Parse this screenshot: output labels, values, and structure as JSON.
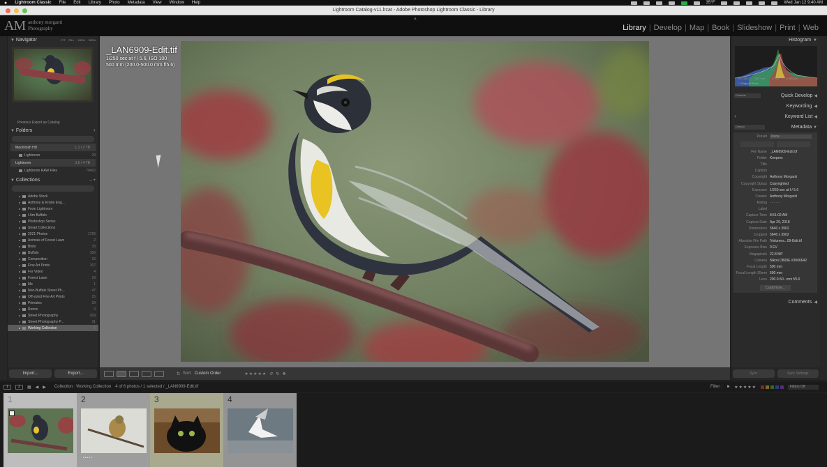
{
  "menubar": {
    "apple": "",
    "items": [
      "Lightroom Classic",
      "File",
      "Edit",
      "Library",
      "Photo",
      "Metadata",
      "View",
      "Window",
      "Help"
    ],
    "temperature": "35°F",
    "clock": "Wed Jan 12  9:40 AM"
  },
  "window": {
    "title": "Lightroom Catalog-v11.lrcat - Adobe Photoshop Lightroom Classic - Library"
  },
  "identity": {
    "initials": "AM",
    "line1": "anthony morganti",
    "line2": "Photography"
  },
  "modules": [
    "Library",
    "Develop",
    "Map",
    "Book",
    "Slideshow",
    "Print",
    "Web"
  ],
  "active_module": "Library",
  "navigator": {
    "title": "Navigator",
    "zoom": [
      "FIT",
      "FILL",
      "100%",
      "200%"
    ]
  },
  "left": {
    "prev_export": "Previous Export as Catalog",
    "folders_title": "Folders",
    "volumes": [
      {
        "name": "Macintosh HD",
        "count": "1.1 / 2 TB"
      },
      {
        "name": "Lightroom",
        "count": "3.5 / 4 TB"
      }
    ],
    "folder_rows": [
      {
        "name": "Lightroom",
        "count": "29"
      },
      {
        "name": "Lightroom RAW Files",
        "count": "70462"
      }
    ],
    "collections_title": "Collections",
    "collections": [
      {
        "name": "Adobe Stock",
        "count": ""
      },
      {
        "name": "Anthony & Kristie Eng...",
        "count": ""
      },
      {
        "name": "From Lightroom",
        "count": ""
      },
      {
        "name": "I Am Buffalo",
        "count": ""
      },
      {
        "name": "Photoshop Series",
        "count": ""
      },
      {
        "name": "Smart Collections",
        "count": ""
      },
      {
        "name": "2021 Photos",
        "count": "1726"
      },
      {
        "name": "Animals of Forest Lawn",
        "count": "2"
      },
      {
        "name": "Birds",
        "count": "33"
      },
      {
        "name": "Buffalo",
        "count": "156"
      },
      {
        "name": "Composition",
        "count": "23"
      },
      {
        "name": "Fine Art Prints",
        "count": "167"
      },
      {
        "name": "For Video",
        "count": "4"
      },
      {
        "name": "Forest Lawn",
        "count": "19"
      },
      {
        "name": "Me",
        "count": "1"
      },
      {
        "name": "Non-Buffalo Street Ph...",
        "count": "47"
      },
      {
        "name": "Off-sized Fine Art Prints",
        "count": "15"
      },
      {
        "name": "Primates",
        "count": "29"
      },
      {
        "name": "Remix",
        "count": "3"
      },
      {
        "name": "Street Photography",
        "count": "269"
      },
      {
        "name": "Street Photography P...",
        "count": "31"
      },
      {
        "name": "Working Collection",
        "count": "6"
      }
    ],
    "selected_collection": "Working Collection",
    "import_label": "Import...",
    "export_label": "Export..."
  },
  "loupe": {
    "filename": "_LAN6909-Edit.tif",
    "exposure_line": "1/250 sec at f / 5.6, ISO 100",
    "lens_line": "500 mm (200.0-500.0 mm f/5.6)"
  },
  "toolbar": {
    "sort_label": "Sort:",
    "sort_value": "Custom Order"
  },
  "right": {
    "histogram_title": "Histogram",
    "histogram_info": [
      "ISO 100",
      "500 mm",
      "f / 5.6",
      "1/250 sec"
    ],
    "original_photo": "Original Photo",
    "quick_develop": "Quick Develop",
    "quick_develop_preset": "Defaults",
    "keywording": "Keywording",
    "keyword_list": "Keyword List",
    "metadata": "Metadata",
    "metadata_preset": "Default",
    "preset_label": "Preset",
    "preset_value": "None",
    "metadata_rows": [
      {
        "label": "File Name",
        "value": "_LAN6909-Edit.tif"
      },
      {
        "label": "Folder",
        "value": "Keepers"
      },
      {
        "label": "Title",
        "value": ""
      },
      {
        "label": "Caption",
        "value": ""
      },
      {
        "label": "Copyright",
        "value": "Anthony Morganti"
      },
      {
        "label": "Copyright Status",
        "value": "Copyrighted"
      },
      {
        "label": "Exposure",
        "value": "1/250 sec at f / 5.6"
      },
      {
        "label": "Creator",
        "value": "Anthony Morganti"
      },
      {
        "label": "Rating",
        "value": "·  ·  ·  ·  ·"
      },
      {
        "label": "Label",
        "value": ""
      },
      {
        "label": "Capture Time",
        "value": "8:51:02 AM"
      },
      {
        "label": "Capture Date",
        "value": "Apr 29, 2018"
      },
      {
        "label": "Dimensions",
        "value": "5846 x 3902"
      },
      {
        "label": "Cropped",
        "value": "5846 x 3902"
      },
      {
        "label": "Absolute File Path",
        "value": "/Volumes...09-Edit.tif"
      },
      {
        "label": "Exposure Bias",
        "value": "0 EV"
      },
      {
        "label": "Megapixels",
        "value": "22.8 MP"
      },
      {
        "label": "Camera",
        "value": "Nikon D800E #3006642"
      },
      {
        "label": "Focal Length",
        "value": "500 mm"
      },
      {
        "label": "Focal Length 35mm",
        "value": "500 mm"
      },
      {
        "label": "Lens",
        "value": "200.0-50...mm f/5.6"
      }
    ],
    "customize": "Customize...",
    "comments": "Comments",
    "sync": "Sync",
    "sync_settings": "Sync Settings"
  },
  "filmstrip_bar": {
    "pages": [
      "1",
      "2"
    ],
    "source": "Collection : Working Collection",
    "count": "4 of 6 photos / 1 selected / _LAN6909-Edit.tif",
    "filter_label": "Filter :",
    "filter_value": "Filters Off"
  },
  "filmstrip": [
    {
      "index": "1",
      "desc": "yellow-rumped warbler"
    },
    {
      "index": "2",
      "desc": "small bird on branch"
    },
    {
      "index": "3",
      "desc": "black cat"
    },
    {
      "index": "4",
      "desc": "seagull in flight"
    }
  ]
}
